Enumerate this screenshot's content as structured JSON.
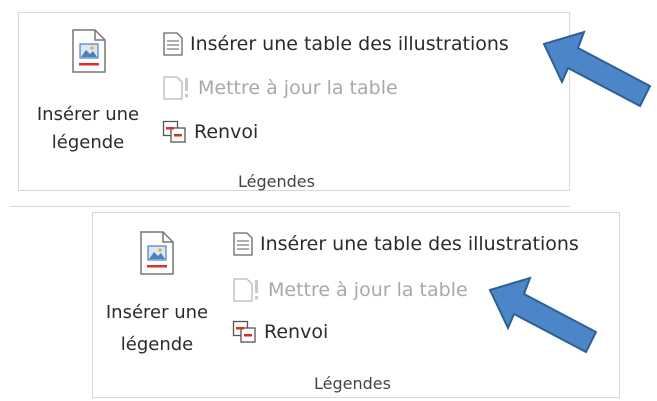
{
  "panels": [
    {
      "insert_caption": {
        "line1": "Insérer une",
        "line2": "légende"
      },
      "commands": [
        {
          "label": "Insérer une table des illustrations",
          "icon": "table-of-figures-icon",
          "disabled": false
        },
        {
          "label": "Mettre à jour la table",
          "icon": "update-table-icon",
          "disabled": true
        },
        {
          "label": "Renvoi",
          "icon": "cross-reference-icon",
          "disabled": false
        }
      ],
      "group_label": "Légendes"
    },
    {
      "insert_caption": {
        "line1": "Insérer une",
        "line2": "légende"
      },
      "commands": [
        {
          "label": "Insérer une table des illustrations",
          "icon": "table-of-figures-icon",
          "disabled": false
        },
        {
          "label": "Mettre à jour la table",
          "icon": "update-table-icon",
          "disabled": true
        },
        {
          "label": "Renvoi",
          "icon": "cross-reference-icon",
          "disabled": false
        }
      ],
      "group_label": "Légendes"
    }
  ],
  "colors": {
    "arrow_fill": "#4a86c8",
    "arrow_stroke": "#2f5f93",
    "disabled_text": "#a8a8a8",
    "accent_red": "#d9302a"
  }
}
